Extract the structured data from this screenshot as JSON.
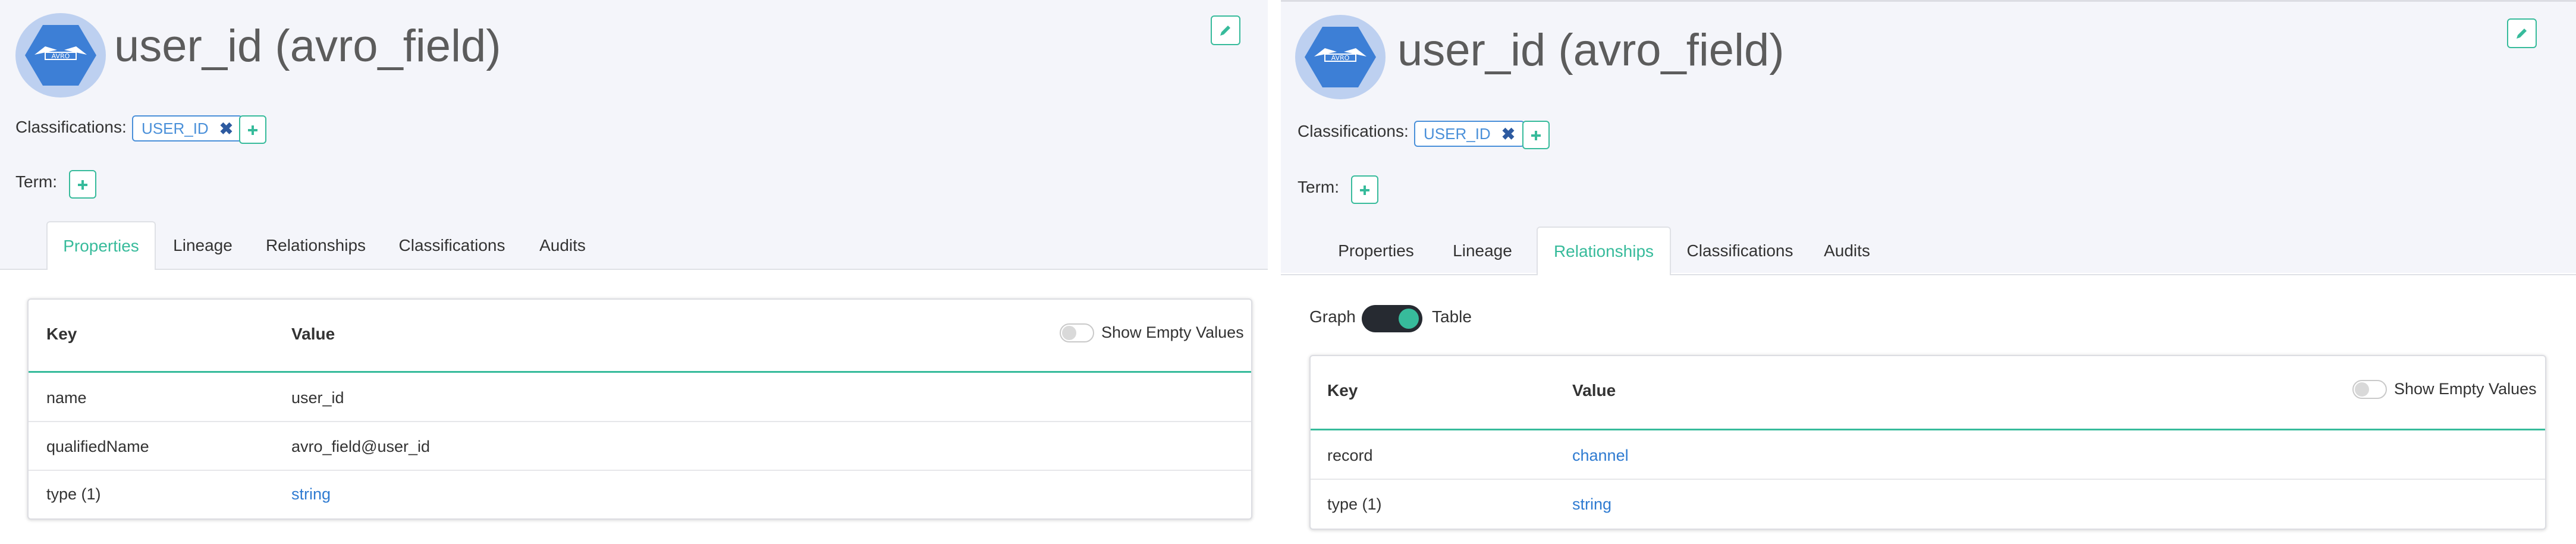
{
  "panels": [
    {
      "title": "user_id (avro_field)",
      "avatar_icon": "avro-logo-icon",
      "edit_icon": "pencil-icon",
      "classifications_label": "Classifications:",
      "classification_tag": "USER_ID",
      "term_label": "Term:",
      "tabs": [
        "Properties",
        "Lineage",
        "Relationships",
        "Classifications",
        "Audits"
      ],
      "active_tab": "Properties",
      "show_empty_label": "Show Empty Values",
      "table": {
        "headers": [
          "Key",
          "Value"
        ],
        "rows": [
          {
            "key": "name",
            "value": "user_id"
          },
          {
            "key": "qualifiedName",
            "value": "avro_field@user_id"
          },
          {
            "key": "type (1)",
            "value": "string"
          }
        ]
      }
    },
    {
      "title": "user_id (avro_field)",
      "avatar_icon": "avro-logo-icon",
      "edit_icon": "pencil-icon",
      "classifications_label": "Classifications:",
      "classification_tag": "USER_ID",
      "term_label": "Term:",
      "tabs": [
        "Properties",
        "Lineage",
        "Relationships",
        "Classifications",
        "Audits"
      ],
      "active_tab": "Relationships",
      "view_toggle": {
        "left_label": "Graph",
        "right_label": "Table",
        "selected": "Table"
      },
      "show_empty_label": "Show Empty Values",
      "table": {
        "headers": [
          "Key",
          "Value"
        ],
        "rows": [
          {
            "key": "record",
            "value": "channel"
          },
          {
            "key": "type (1)",
            "value": "string"
          }
        ]
      }
    }
  ],
  "colors": {
    "accent": "#37bb9b",
    "link": "#2f7bd1",
    "tag": "#4a90d9"
  }
}
